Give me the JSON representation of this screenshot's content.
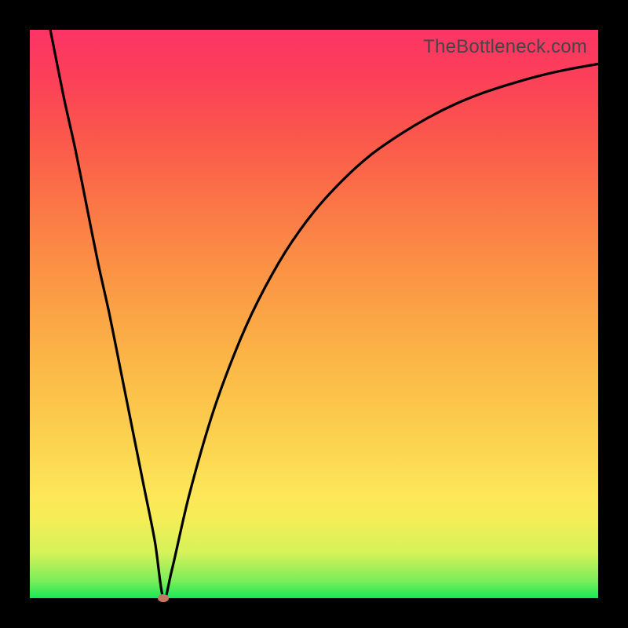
{
  "credit_text": "TheBottleneck.com",
  "chart_data": {
    "type": "line",
    "title": "",
    "xlabel": "",
    "ylabel": "",
    "xlim": [
      0,
      100
    ],
    "ylim": [
      0,
      100
    ],
    "grid": false,
    "x": [
      0,
      2,
      4,
      6,
      8,
      10,
      12,
      14,
      16,
      18,
      20,
      22,
      23.5,
      25,
      28,
      32,
      36,
      40,
      45,
      50,
      55,
      60,
      65,
      70,
      75,
      80,
      85,
      90,
      95,
      100
    ],
    "values": [
      118,
      108,
      98,
      88,
      79,
      69,
      59,
      50,
      40,
      30,
      20,
      10,
      0,
      5,
      18,
      32,
      43,
      52,
      61,
      68,
      73.5,
      78,
      81.5,
      84.5,
      87,
      89,
      90.6,
      92,
      93.1,
      94
    ],
    "min_point": {
      "x": 23.5,
      "y": 0
    },
    "background_gradient": {
      "type": "vertical",
      "stops": [
        {
          "pos": 0,
          "color": "#18e858"
        },
        {
          "pos": 0.14,
          "color": "#fde758"
        },
        {
          "pos": 0.5,
          "color": "#fba445"
        },
        {
          "pos": 1.0,
          "color": "#fd3465"
        }
      ]
    }
  }
}
